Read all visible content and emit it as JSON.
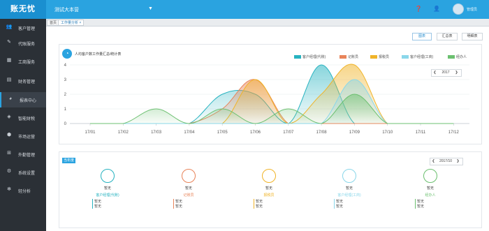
{
  "header": {
    "logo": "账无忧",
    "org": "测试大本营",
    "user": "管理员"
  },
  "sidebar": {
    "items": [
      {
        "label": "客户管理",
        "icon": "users-icon"
      },
      {
        "label": "代账服务",
        "icon": "edit-icon"
      },
      {
        "label": "工商服务",
        "icon": "briefcase-icon"
      },
      {
        "label": "财务管理",
        "icon": "finance-icon"
      },
      {
        "label": "报表中心",
        "icon": "pie-chart-icon"
      },
      {
        "label": "智能财税",
        "icon": "cube-icon"
      },
      {
        "label": "市场运营",
        "icon": "market-icon"
      },
      {
        "label": "外勤管理",
        "icon": "field-icon"
      },
      {
        "label": "系统设置",
        "icon": "settings-icon"
      },
      {
        "label": "轻分析",
        "icon": "gear-icon"
      }
    ]
  },
  "tabs": [
    {
      "label": "首页"
    },
    {
      "label": "工作量分析 ×"
    }
  ],
  "view_buttons": [
    "图表",
    "汇总表",
    "明细表"
  ],
  "chart": {
    "title": "人均客户数工作量汇总/统计表",
    "year": "2017"
  },
  "chart_data": {
    "type": "area",
    "categories": [
      "17/01",
      "17/02",
      "17/03",
      "17/04",
      "17/05",
      "17/06",
      "17/07",
      "17/08",
      "17/09",
      "17/10",
      "17/11",
      "17/12"
    ],
    "ylim": [
      0,
      4
    ],
    "yticks": [
      "0",
      "1",
      "2",
      "3",
      "4"
    ],
    "legend_position": "top-right",
    "series": [
      {
        "name": "客户经理(代账)",
        "color": "#27b3c0",
        "values": [
          0,
          0,
          0,
          0,
          2,
          2,
          0,
          4,
          0,
          0,
          0,
          0
        ]
      },
      {
        "name": "记账员",
        "color": "#e8845a",
        "values": [
          0,
          0,
          0,
          0,
          1,
          3,
          0,
          0,
          0,
          0,
          0,
          0
        ]
      },
      {
        "name": "报税员",
        "color": "#f0b429",
        "values": [
          0,
          0,
          0,
          0,
          0,
          3,
          0,
          2,
          4,
          0,
          0,
          0
        ]
      },
      {
        "name": "客户经理(工商)",
        "color": "#8ad7ea",
        "values": [
          0,
          0,
          0,
          0,
          0,
          0,
          0,
          0,
          3,
          0,
          0,
          0
        ]
      },
      {
        "name": "经办人",
        "color": "#6cc070",
        "values": [
          0,
          0,
          1,
          0,
          1,
          0,
          1,
          0,
          2,
          0,
          0,
          0
        ]
      }
    ]
  },
  "summary": {
    "badge": "当年度",
    "period": "2017/10",
    "stats": [
      {
        "ring_color": "#27b3c0",
        "value": "暂无",
        "role": "客户经理(代账)",
        "lines": [
          "暂无",
          "暂无"
        ]
      },
      {
        "ring_color": "#e8845a",
        "value": "暂无",
        "role": "记账员",
        "lines": [
          "暂无",
          "暂无"
        ]
      },
      {
        "ring_color": "#f0b429",
        "value": "暂无",
        "role": "报税员",
        "lines": [
          "暂无",
          "暂无"
        ]
      },
      {
        "ring_color": "#8ad7ea",
        "value": "暂无",
        "role": "客户经理(工商)",
        "lines": [
          "暂无",
          "暂无"
        ]
      },
      {
        "ring_color": "#6cc070",
        "value": "暂无",
        "role": "经办人",
        "lines": [
          "暂无",
          "暂无"
        ]
      }
    ]
  }
}
